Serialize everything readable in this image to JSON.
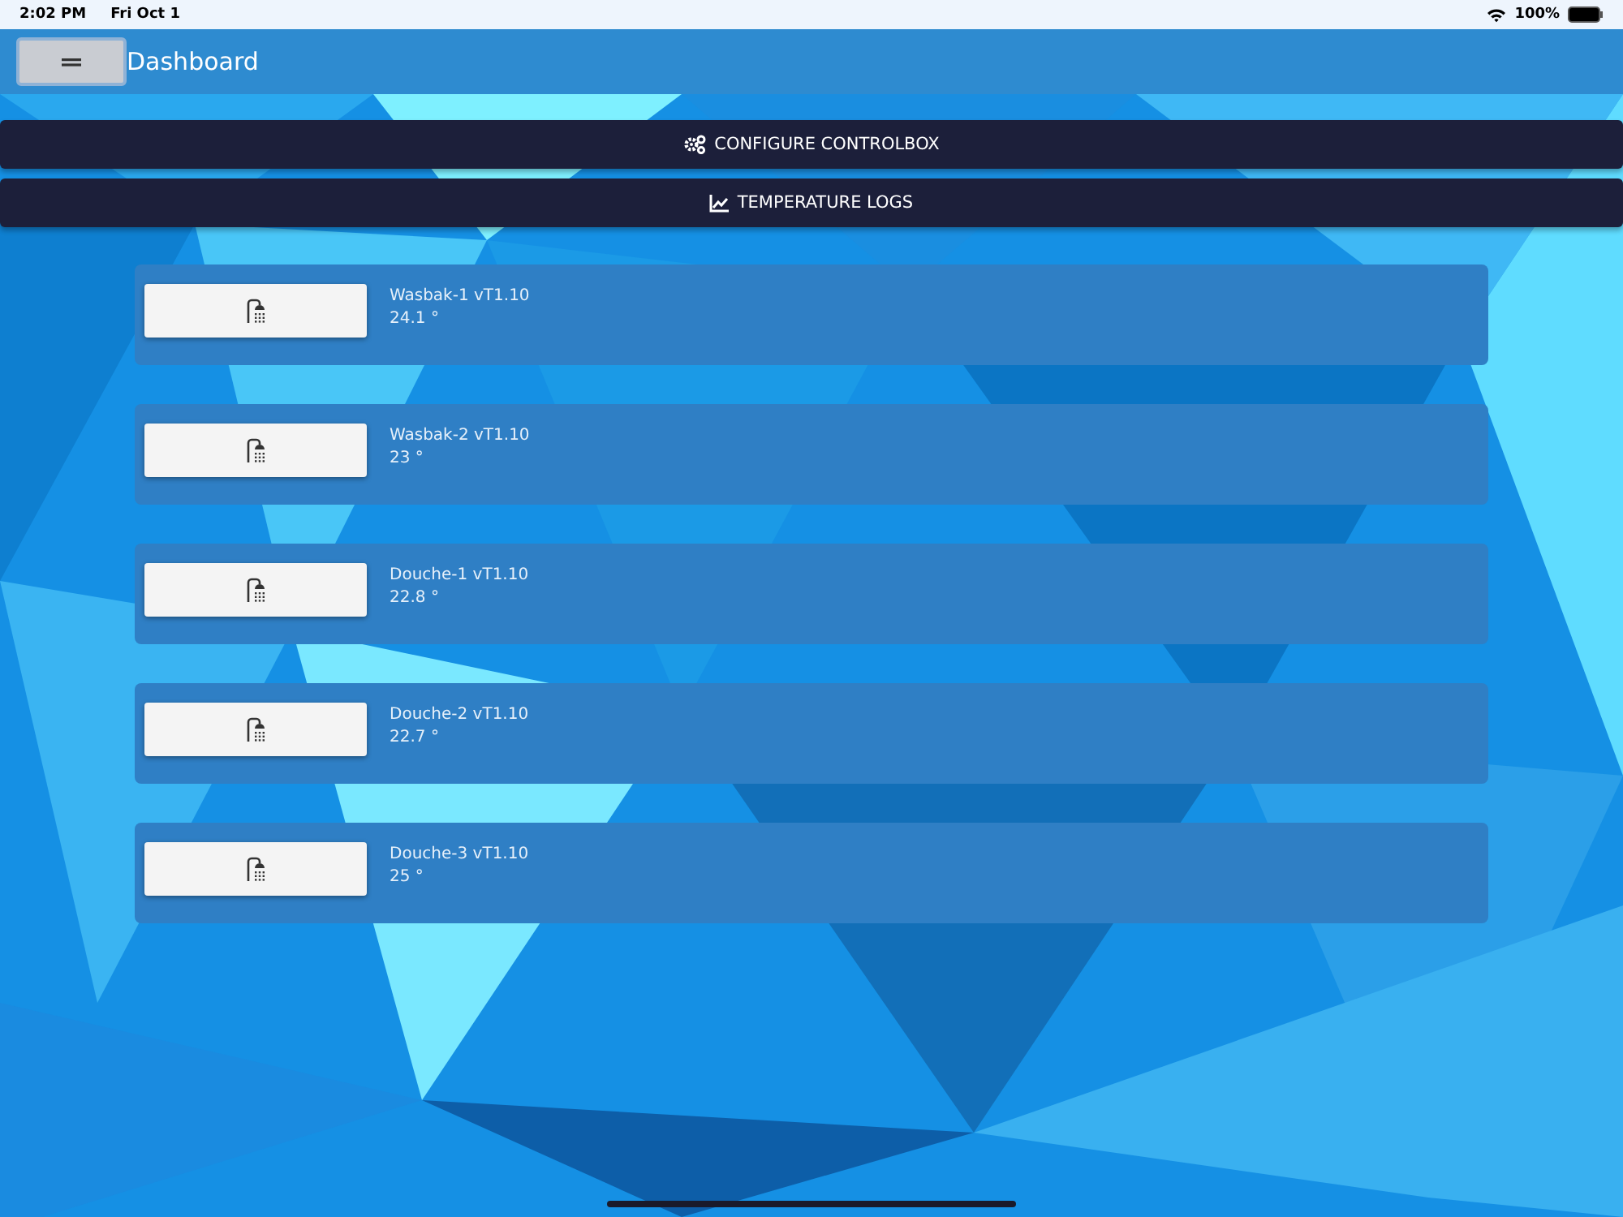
{
  "status_bar": {
    "time": "2:02 PM",
    "date": "Fri Oct 1",
    "battery": "100%"
  },
  "header": {
    "title": "Dashboard"
  },
  "actions": [
    {
      "kind": "configure",
      "label": "CONFIGURE CONTROLBOX"
    },
    {
      "kind": "logs",
      "label": "TEMPERATURE LOGS"
    }
  ],
  "devices": [
    {
      "name": "Wasbak-1 vT1.10",
      "temperature": "24.1 °"
    },
    {
      "name": "Wasbak-2 vT1.10",
      "temperature": "23 °"
    },
    {
      "name": "Douche-1 vT1.10",
      "temperature": "22.8 °"
    },
    {
      "name": "Douche-2 vT1.10",
      "temperature": "22.7 °"
    },
    {
      "name": "Douche-3 vT1.10",
      "temperature": "25 °"
    }
  ]
}
